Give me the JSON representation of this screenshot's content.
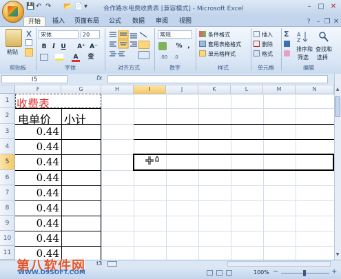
{
  "window": {
    "title": "合作路水电费收费表 [兼容模式] - Microsoft Excel",
    "min_glyph": "–",
    "max_glyph": "□",
    "close_glyph": "✕"
  },
  "qat": {
    "save_glyph": "💾",
    "undo_glyph": "↶",
    "redo_glyph": "↷",
    "open_glyph": "📂",
    "new_glyph": "📄",
    "more_glyph": "▾"
  },
  "tabs": [
    {
      "label": "开始",
      "active": true
    },
    {
      "label": "插入"
    },
    {
      "label": "页面布局"
    },
    {
      "label": "公式"
    },
    {
      "label": "数据"
    },
    {
      "label": "审阅"
    },
    {
      "label": "视图"
    }
  ],
  "ribbon_right": {
    "help_glyph": "?",
    "min_glyph": "–",
    "restore_glyph": "❐",
    "close_glyph": "✕"
  },
  "ribbon": {
    "clipboard": {
      "label": "剪贴板",
      "paste": "粘贴"
    },
    "font": {
      "label": "字体",
      "name": "宋体",
      "size": "20",
      "bold": "B",
      "italic": "I",
      "underline": "U",
      "grow": "A⁺",
      "shrink": "A⁻",
      "color_a": "A",
      "wen": "变"
    },
    "alignment": {
      "label": "对齐方式"
    },
    "number": {
      "label": "数字",
      "format": "常规",
      "percent": "%",
      "comma": ","
    },
    "styles": {
      "label": "样式",
      "cond": "条件格式",
      "table": "套用表格格式",
      "cell": "单元格样式"
    },
    "cells": {
      "label": "单元格",
      "insert": "插入",
      "delete": "删除",
      "format": "格式"
    },
    "editing": {
      "label": "编辑",
      "sort": "排序和",
      "filter": "筛选",
      "find": "查找和",
      "select": "选择"
    }
  },
  "formula_bar": {
    "name_box": "I5",
    "fx": "fx",
    "value": ""
  },
  "columns": [
    "F",
    "G",
    "H",
    "I",
    "J",
    "K",
    "L",
    "M",
    "N"
  ],
  "active_column": "I",
  "rows": [
    "1",
    "2",
    "3",
    "4",
    "5",
    "6",
    "7",
    "8",
    "9",
    "10",
    "11"
  ],
  "active_row": "5",
  "cells": {
    "F1": "收费表",
    "F2": "电单价",
    "G2": "小计",
    "prices": [
      "0.44",
      "0.44",
      "0.44",
      "0.44",
      "0.44",
      "0.44",
      "0.44",
      "0.44",
      "0.44",
      "0.44"
    ]
  },
  "sheet_tab_partial": "t3",
  "status": {
    "zoom": "100%",
    "zoom_out": "−",
    "zoom_in": "+"
  },
  "watermark": {
    "main": "第八软件网",
    "sub": "WWW.D9SOFT.COM"
  },
  "colors": {
    "title_red": "#e03030",
    "active_header": "#f5c766"
  }
}
